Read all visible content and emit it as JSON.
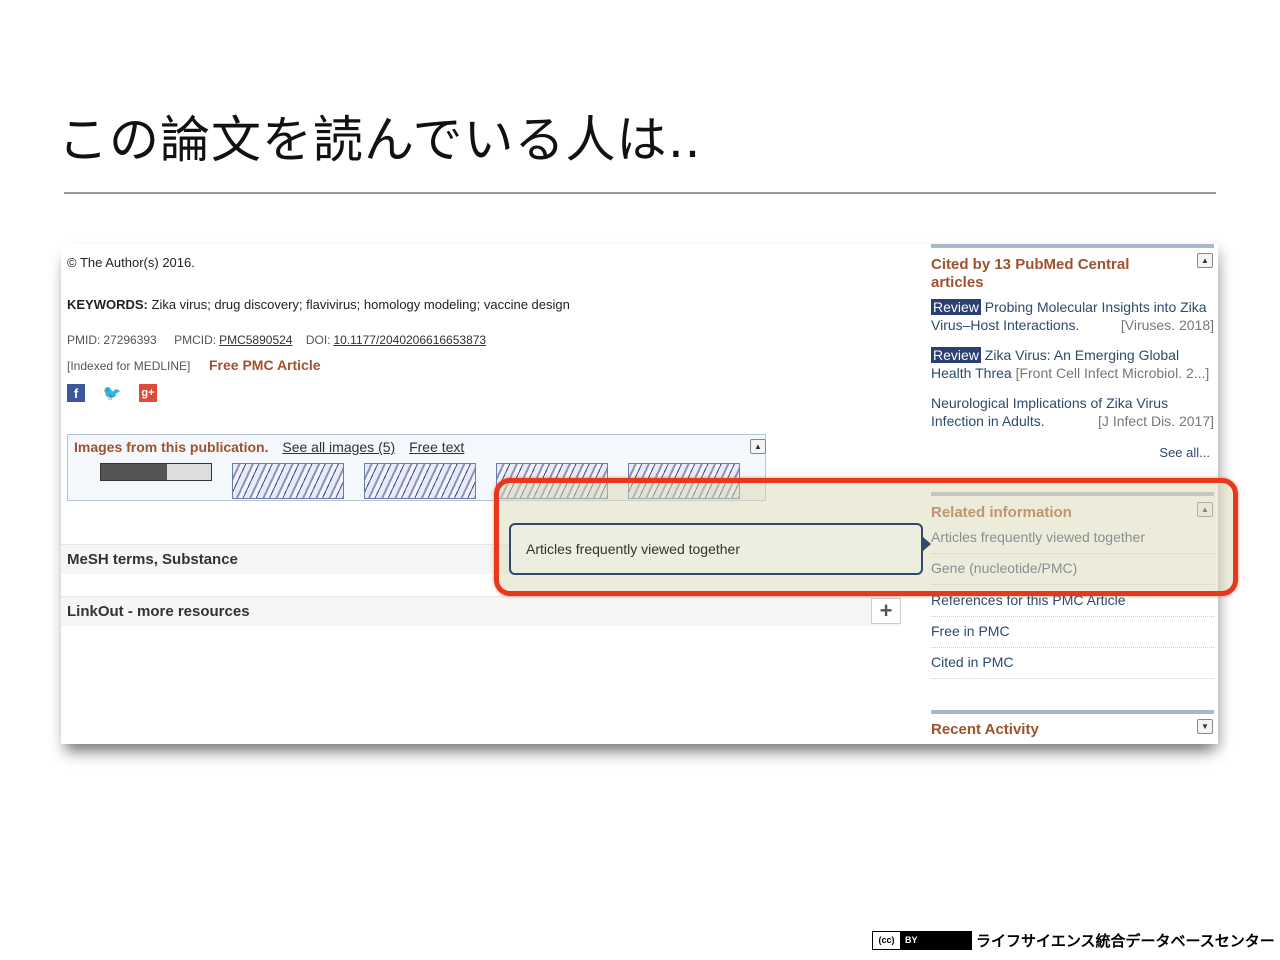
{
  "slide": {
    "title": "この論文を読んでいる人は‥",
    "footer_org": "ライフサイエンス統合データベースセンター",
    "license_cc": "(cc)",
    "license_by": "BY"
  },
  "article": {
    "copyright": "© The Author(s) 2016.",
    "keywords_label": "KEYWORDS:",
    "keywords": "Zika virus; drug discovery; flavivirus; homology modeling; vaccine design",
    "pmid_label": "PMID:",
    "pmid": "27296393",
    "pmcid_label": "PMCID:",
    "pmcid": "PMC5890524",
    "doi_label": "DOI:",
    "doi": "10.1177/2040206616653873",
    "indexed": "[Indexed for MEDLINE]",
    "free_pmc": "Free PMC Article",
    "social": {
      "facebook": "f",
      "twitter": "🐦",
      "gplus": "g+"
    }
  },
  "images_panel": {
    "title": "Images from this publication.",
    "see_all": "See all images (5)",
    "free_text": "Free text"
  },
  "sections": {
    "mesh": "MeSH terms, Substance",
    "linkout": "LinkOut - more resources",
    "expand_symbol": "+"
  },
  "sidebar": {
    "cited_title": "Cited by 13 PubMed Central articles",
    "citations": [
      {
        "badge": "Review",
        "text": "Probing Molecular Insights into Zika Virus–Host Interactions.",
        "source": "[Viruses. 2018]"
      },
      {
        "badge": "Review",
        "text": "Zika Virus: An Emerging Global Health Threa",
        "source": "[Front Cell Infect Microbiol. 2...]"
      },
      {
        "badge": "",
        "text": "Neurological Implications of Zika Virus Infection in Adults.",
        "source": "[J Infect Dis. 2017]"
      }
    ],
    "see_all": "See all...",
    "related_title": "Related information",
    "related_items": [
      "Articles frequently viewed together",
      "Gene (nucleotide/PMC)",
      "References for this PMC Article",
      "Free in PMC",
      "Cited in PMC"
    ],
    "recent_title": "Recent Activity"
  },
  "tooltip": {
    "text": "Articles frequently viewed together"
  },
  "colors": {
    "accent": "#a0522d",
    "link": "#2e4a6e",
    "highlight": "#e8381b",
    "badge": "#2b3f73"
  },
  "icons": {
    "collapse": "▲",
    "expand": "▼"
  }
}
